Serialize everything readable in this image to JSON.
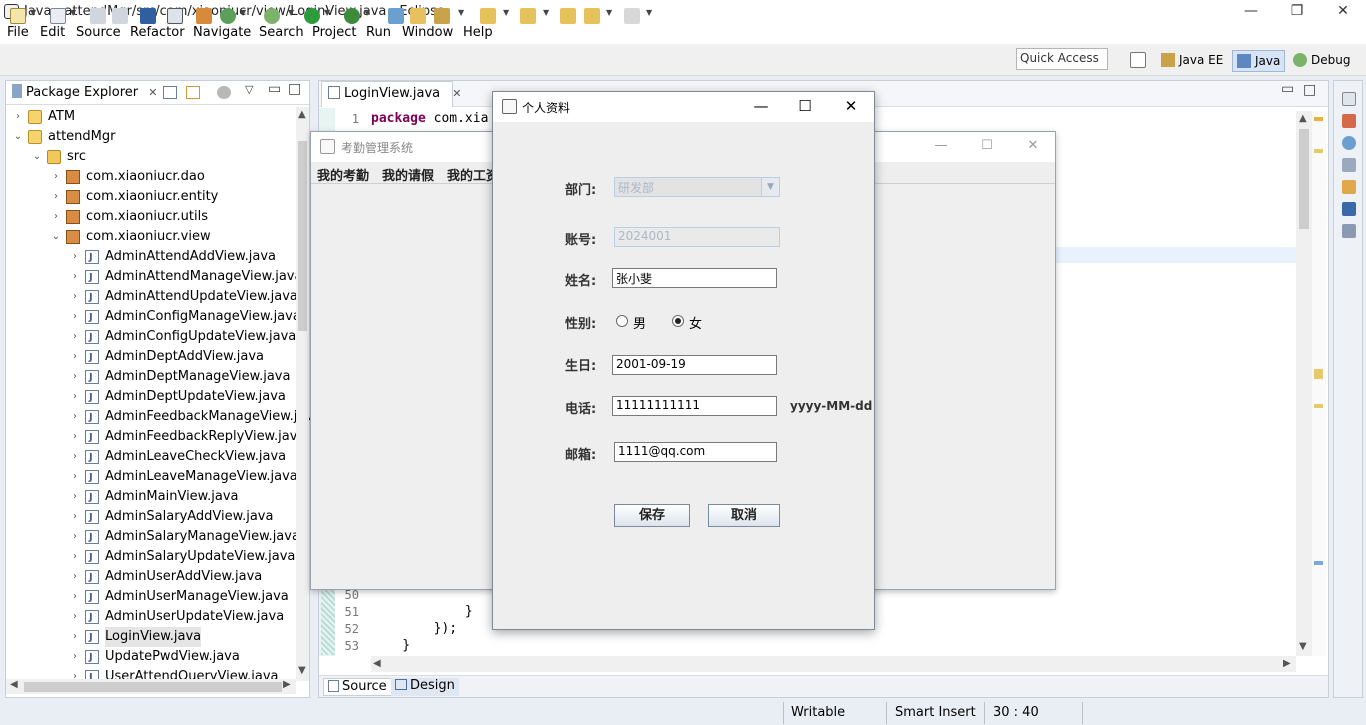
{
  "window": {
    "title": "Java - attendMgr/src/com/xiaoniucr/view/LoginView.java - Eclipse"
  },
  "menu": [
    "File",
    "Edit",
    "Source",
    "Refactor",
    "Navigate",
    "Search",
    "Project",
    "Run",
    "Window",
    "Help"
  ],
  "quick_access": "Quick Access",
  "perspectives": [
    "Java EE",
    "Java",
    "Debug"
  ],
  "package_explorer": {
    "title": "Package Explorer",
    "tree": [
      {
        "label": "ATM",
        "kind": "project",
        "depth": 0,
        "toggle": "›"
      },
      {
        "label": "attendMgr",
        "kind": "project",
        "depth": 0,
        "toggle": "⌄"
      },
      {
        "label": "src",
        "kind": "folder",
        "depth": 1,
        "toggle": "⌄"
      },
      {
        "label": "com.xiaoniucr.dao",
        "kind": "pkg",
        "depth": 2,
        "toggle": "›"
      },
      {
        "label": "com.xiaoniucr.entity",
        "kind": "pkg",
        "depth": 2,
        "toggle": "›"
      },
      {
        "label": "com.xiaoniucr.utils",
        "kind": "pkg",
        "depth": 2,
        "toggle": "›"
      },
      {
        "label": "com.xiaoniucr.view",
        "kind": "pkg",
        "depth": 2,
        "toggle": "⌄"
      },
      {
        "label": "AdminAttendAddView.java",
        "kind": "java",
        "depth": 3,
        "toggle": "›"
      },
      {
        "label": "AdminAttendManageView.java",
        "kind": "java",
        "depth": 3,
        "toggle": "›"
      },
      {
        "label": "AdminAttendUpdateView.java",
        "kind": "java",
        "depth": 3,
        "toggle": "›"
      },
      {
        "label": "AdminConfigManageView.java",
        "kind": "java",
        "depth": 3,
        "toggle": "›"
      },
      {
        "label": "AdminConfigUpdateView.java",
        "kind": "java",
        "depth": 3,
        "toggle": "›"
      },
      {
        "label": "AdminDeptAddView.java",
        "kind": "java",
        "depth": 3,
        "toggle": "›"
      },
      {
        "label": "AdminDeptManageView.java",
        "kind": "java",
        "depth": 3,
        "toggle": "›"
      },
      {
        "label": "AdminDeptUpdateView.java",
        "kind": "java",
        "depth": 3,
        "toggle": "›"
      },
      {
        "label": "AdminFeedbackManageView.jav",
        "kind": "java",
        "depth": 3,
        "toggle": "›"
      },
      {
        "label": "AdminFeedbackReplyView.java",
        "kind": "java",
        "depth": 3,
        "toggle": "›"
      },
      {
        "label": "AdminLeaveCheckView.java",
        "kind": "java",
        "depth": 3,
        "toggle": "›"
      },
      {
        "label": "AdminLeaveManageView.java",
        "kind": "java",
        "depth": 3,
        "toggle": "›"
      },
      {
        "label": "AdminMainView.java",
        "kind": "java",
        "depth": 3,
        "toggle": "›"
      },
      {
        "label": "AdminSalaryAddView.java",
        "kind": "java",
        "depth": 3,
        "toggle": "›"
      },
      {
        "label": "AdminSalaryManageView.java",
        "kind": "java",
        "depth": 3,
        "toggle": "›"
      },
      {
        "label": "AdminSalaryUpdateView.java",
        "kind": "java",
        "depth": 3,
        "toggle": "›"
      },
      {
        "label": "AdminUserAddView.java",
        "kind": "java",
        "depth": 3,
        "toggle": "›"
      },
      {
        "label": "AdminUserManageView.java",
        "kind": "java",
        "depth": 3,
        "toggle": "›"
      },
      {
        "label": "AdminUserUpdateView.java",
        "kind": "java",
        "depth": 3,
        "toggle": "›"
      },
      {
        "label": "LoginView.java",
        "kind": "java",
        "depth": 3,
        "toggle": "›",
        "selected": true
      },
      {
        "label": "UpdatePwdView.java",
        "kind": "java",
        "depth": 3,
        "toggle": "›"
      },
      {
        "label": "UserAttendQueryView.java",
        "kind": "java",
        "depth": 3,
        "toggle": "›"
      }
    ]
  },
  "editor": {
    "tab": "LoginView.java",
    "first_line": {
      "num": "1",
      "keyword": "package",
      "rest": " com.xia"
    },
    "bottom_lines": [
      {
        "num": "50",
        "code": ""
      },
      {
        "num": "51",
        "code": "            }"
      },
      {
        "num": "52",
        "code": "        });"
      },
      {
        "num": "53",
        "code": "    }"
      }
    ],
    "bottom_tabs": [
      "Source",
      "Design"
    ]
  },
  "status": {
    "writable": "Writable",
    "insert_mode": "Smart Insert",
    "position": "30 : 40"
  },
  "bg_frame": {
    "title": "考勤管理系统",
    "menu": [
      "我的考勤",
      "我的请假",
      "我的工资"
    ]
  },
  "dialog": {
    "title": "个人资料",
    "dept_label": "部门:",
    "dept_value": "研发部",
    "account_label": "账号:",
    "account_value": "2024001",
    "name_label": "姓名:",
    "name_value": "张小斐",
    "gender_label": "性别:",
    "gender_options": [
      "男",
      "女"
    ],
    "gender_selected": "女",
    "birthday_label": "生日:",
    "birthday_value": "2001-09-19",
    "phone_label": "电话:",
    "phone_value": "11111111111",
    "date_hint": "yyyy-MM-dd",
    "email_label": "邮箱:",
    "email_value": "1111@qq.com",
    "save_label": "保存",
    "cancel_label": "取消"
  }
}
